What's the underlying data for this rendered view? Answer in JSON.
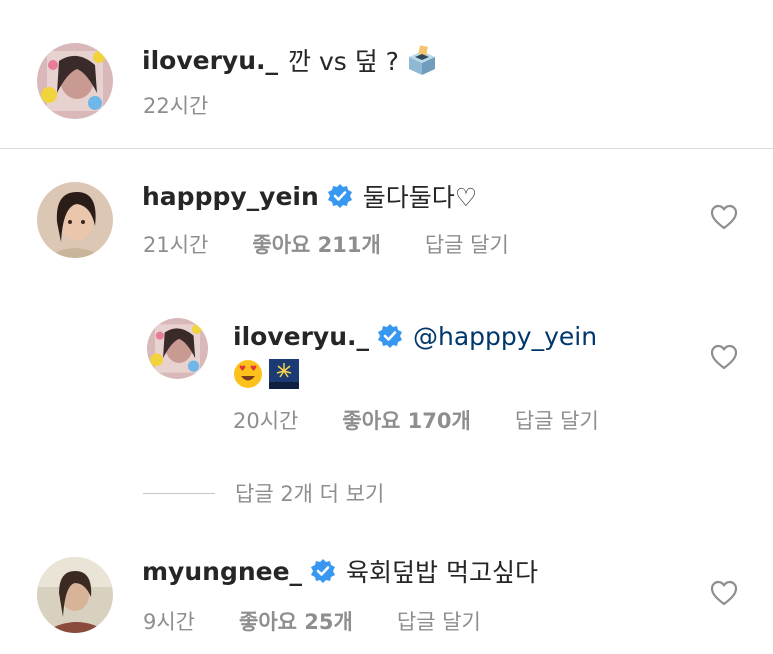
{
  "caption": {
    "username": "iloveryu._",
    "text": "깐 vs 덮 ?",
    "emoji": "ballot-box",
    "time": "22시간"
  },
  "comments": [
    {
      "username": "happpy_yein",
      "verified": true,
      "text": "둘다둘다♡",
      "time": "21시간",
      "likes": "좋아요 211개",
      "reply_label": "답글 달기"
    },
    {
      "username": "iloveryu._",
      "verified": true,
      "mention": "@happpy_yein",
      "emojis": [
        "heart-eyes-emoji",
        "fireworks-emoji"
      ],
      "time": "20시간",
      "likes": "좋아요 170개",
      "reply_label": "답글 달기"
    },
    {
      "username": "myungnee_",
      "verified": true,
      "text": "육회덮밥 먹고싶다",
      "time": "9시간",
      "likes": "좋아요 25개",
      "reply_label": "답글 달기"
    }
  ],
  "view_more_replies": "답글 2개 더 보기",
  "colors": {
    "text": "#262626",
    "secondary": "#8e8e8e",
    "verified": "#3897f0",
    "mention": "#00376b",
    "divider": "#dbdbdb"
  }
}
